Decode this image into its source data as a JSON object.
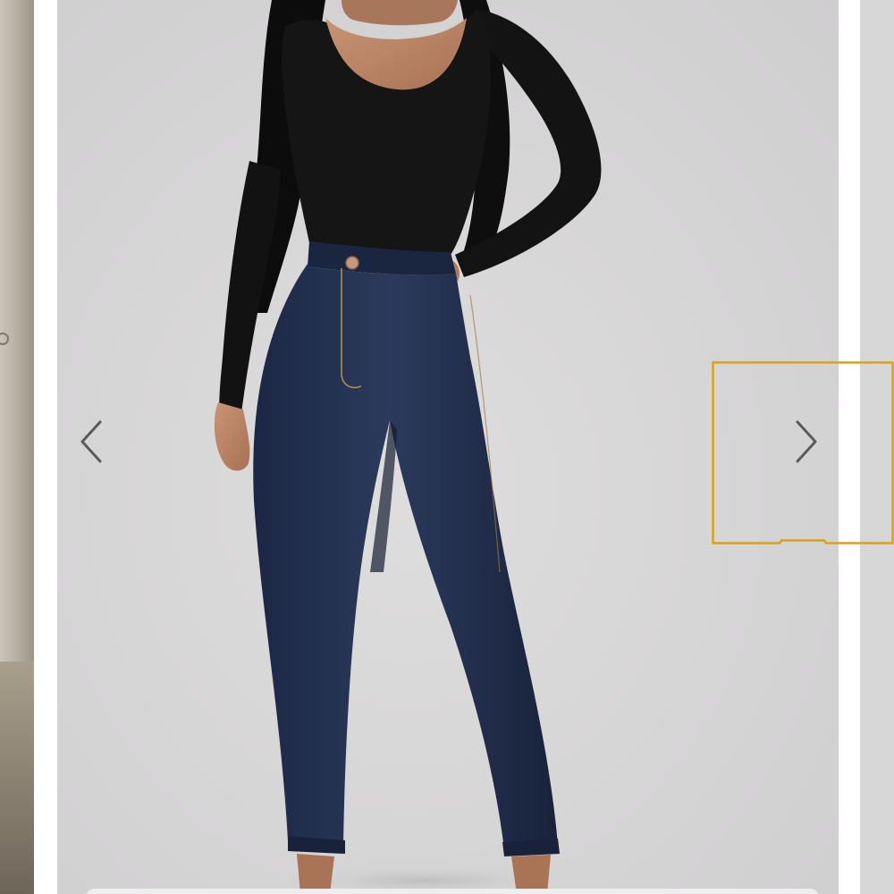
{
  "gallery": {
    "prev_arrow_icon": "chevron-left-icon",
    "next_arrow_icon": "chevron-right-icon",
    "highlight_color": "#d9a21a",
    "background_color": "#d6d5d6"
  },
  "photo": {
    "top_color": "#151515",
    "denim_color": "#1f2c4a",
    "skin_color": "#b98566",
    "hair_color": "#0c0c0c"
  }
}
